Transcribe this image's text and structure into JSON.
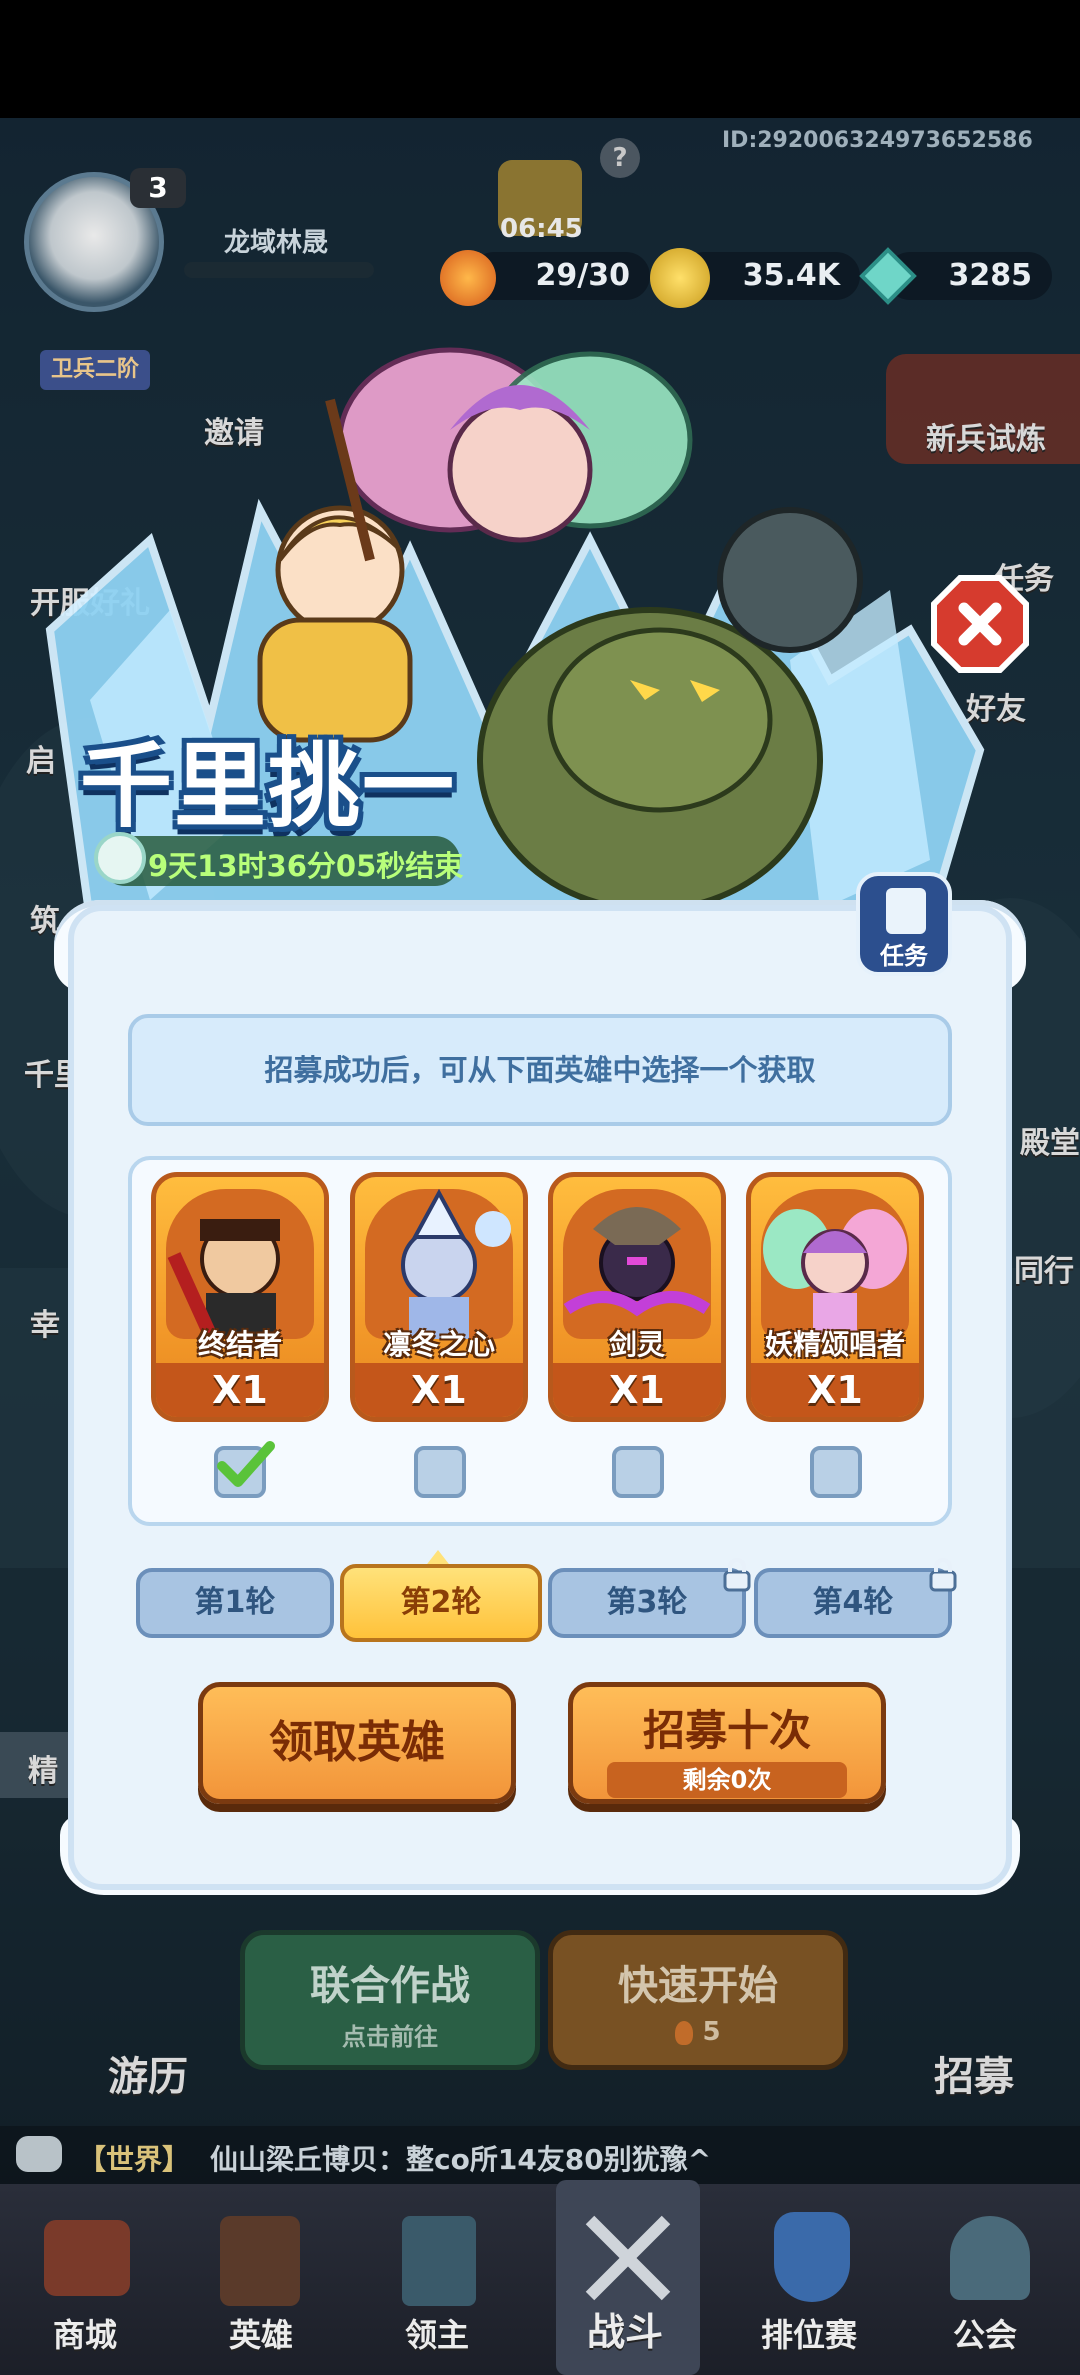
{
  "player": {
    "id": "ID:292006324973652586",
    "level": "3",
    "name": "龙域林晟",
    "rank": "卫兵二阶"
  },
  "timer_badge": "06:45",
  "resources": {
    "stamina": "29/30",
    "gold": "35.4K",
    "gems": "3285"
  },
  "side_left": [
    "邀请",
    "开服好礼",
    "启",
    "筑",
    "千里",
    "幸",
    "精"
  ],
  "side_right": [
    "新兵试炼",
    "任务",
    "好友",
    "殿堂",
    "同行",
    "招募"
  ],
  "event": {
    "title": "千里挑一",
    "countdown": "9天13时36分05秒结束",
    "task_label": "任务"
  },
  "panel": {
    "info": "招募成功后，可从下面英雄中选择一个获取",
    "heroes": [
      {
        "name": "终结者",
        "qty": "X1",
        "checked": true
      },
      {
        "name": "凛冬之心",
        "qty": "X1",
        "checked": false
      },
      {
        "name": "剑灵",
        "qty": "X1",
        "checked": false
      },
      {
        "name": "妖精颂唱者",
        "qty": "X1",
        "checked": false
      }
    ],
    "rounds": [
      {
        "label": "第1轮",
        "state": "off",
        "locked": false
      },
      {
        "label": "第2轮",
        "state": "on",
        "locked": false
      },
      {
        "label": "第3轮",
        "state": "off",
        "locked": true
      },
      {
        "label": "第4轮",
        "state": "off",
        "locked": true
      }
    ],
    "claim_button": "领取英雄",
    "recruit_button": "招募十次",
    "recruit_remaining": "剩余0次"
  },
  "lobby": {
    "coop_title": "联合作战",
    "coop_sub": "点击前往",
    "quick_title": "快速开始",
    "quick_cost": "5",
    "travel": "游历",
    "recruit": "招募"
  },
  "chat": {
    "channel": "【世界】",
    "message": "仙山梁丘博贝：整co所14友80别犹豫^"
  },
  "nav": [
    "商城",
    "英雄",
    "领主",
    "战斗",
    "排位赛",
    "公会"
  ],
  "colors": {
    "accent": "#ffc23a",
    "brand_orange": "#f2953a",
    "panel_bg": "#e9f3fb"
  }
}
